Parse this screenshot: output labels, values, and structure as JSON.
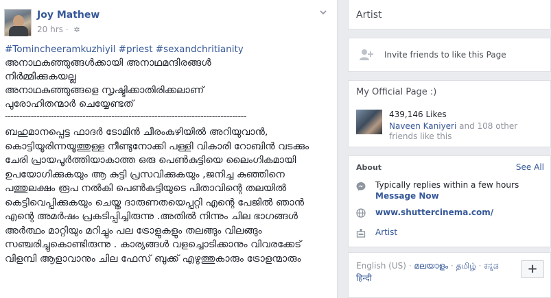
{
  "post": {
    "author": "Joy Mathew",
    "time": "20 hrs",
    "time_sep": "·",
    "audience_icon": "gear-icon",
    "hashtags": "#Tomincheeramkuzhiyil #priest #sexandchritianity",
    "intro": "അനാഥകുഞ്ഞുങ്ങൾക്കായി അനാഥമന്ദിരങ്ങൾ\nനിർമ്മിക്കുകയല്ല\nഅനാഥകുഞ്ഞുങ്ങളെ സൃഷ്ടിക്കാതിരിക്കലാണ്\nപുരോഹിതന്മാർ ചെയ്യേണ്ടത്",
    "divider": "------------------------------------------------------------------------------------",
    "body": "ബഹുമാനപ്പെട്ട ഫാദർ ടോമിൻ ചീരംകുഴിയിൽ അറിയുവാൻ, കൊട്ടിയൂരിന്നയൂത്തുള്ള നീണ്ടുനോക്കി പള്ളി വികാരി റോബിൻ വടക്കും ചേരി പ്രായപൂർത്തിയാകാത്ത ഒരു പെൺകുട്ടിയെ ലൈംഗികമായി ഉപയോഗിക്കുകയും ആ കുട്ടി പ്രസവിക്കുകയും ,ജനിച്ച കുഞ്ഞിനെ പത്തുലക്ഷം രൂപ നൽകി പെൺകുട്ടിയുടെ പിതാവിന്റെ തലയിൽ കെട്ടിവെപ്പിക്കുകയും ചെയ്ത ദാരുണതയെപ്പറ്റി എന്റെ പേജിൽ ഞാൻ എന്റെ അമർഷം പ്രകടിപ്പിച്ചിരുന്നു .അതിൽ നിന്നും ചില ഭാഗങ്ങൾ അർത്ഥം മാറ്റിയും മറിച്ചും പല ട്രോളുകളും തലങ്ങും വിലങ്ങും സഞ്ചരിച്ചുകൊണ്ടിരുന്നു . കാര്യങ്ങൾ വളച്ചൊടിക്കാനും വിവരക്കേട് വിളമ്പി ആളാവാനും ചില ഫേസ് ബുക്ക് എഴുത്തുകാരും ട്രോളന്മാരും"
  },
  "sidebar": {
    "page_category": "Artist",
    "invite_text": "Invite friends to like this Page",
    "official_title": "My Official Page :)",
    "likes": "439,146 Likes",
    "friend_name": "Naveen Kaniyeri",
    "friends_text": " and 108 other friends like this",
    "about_title": "About",
    "see_all": "See All",
    "reply_text": "Typically replies within a few hours",
    "message_now": "Message Now",
    "website": "www.shuttercinema.com/",
    "category": "Artist",
    "languages": {
      "english": "English (US)",
      "malayalam": "മലയാളം",
      "tamil": "தமிழ்",
      "kannada": "ಕನ್ನಡ",
      "hindi": "हिन्दी",
      "sep": " · "
    },
    "add_label": "+"
  },
  "colors": {
    "link": "#365899",
    "meta": "#90949c",
    "text": "#1d2129",
    "background": "#e9ebee"
  }
}
